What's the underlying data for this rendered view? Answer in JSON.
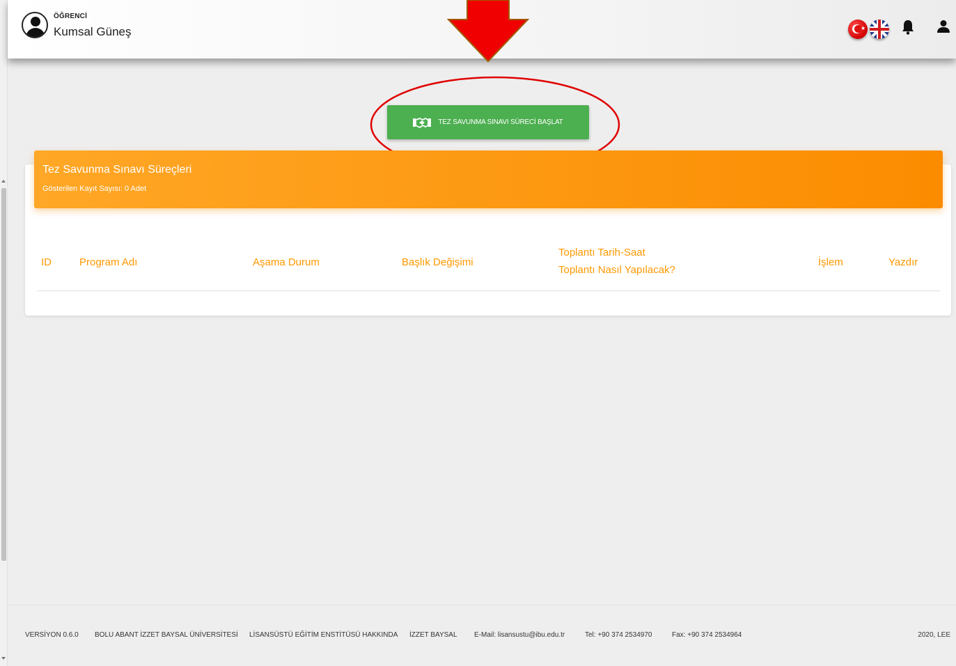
{
  "header": {
    "role": "ÖĞRENCİ",
    "username": "Kumsal Güneş",
    "icons": [
      "avatar-icon",
      "turkish-flag-icon",
      "uk-flag-icon",
      "bell-icon",
      "user-icon"
    ]
  },
  "main": {
    "start_button_label": "TEZ SAVUNMA SINAVI SÜRECİ BAŞLAT",
    "card": {
      "title": "Tez Savunma Sınavı Süreçleri",
      "subtitle": "Gösterilen Kayıt Sayısı: 0 Adet",
      "columns": {
        "id": "ID",
        "program": "Program Adı",
        "stage": "Aşama Durum",
        "title_change": "Başlık Değişimi",
        "meeting_datetime": "Toplantı Tarih-Saat",
        "meeting_method": "Toplantı Nasıl Yapılacak?",
        "action": "İşlem",
        "print": "Yazdır"
      },
      "rows": []
    }
  },
  "footer": {
    "version": "VERSİYON 0.6.0",
    "university": "BOLU ABANT İZZET BAYSAL ÜNİVERSİTESİ",
    "about": "LİSANSÜSTÜ EĞİTİM ENSTİTÜSÜ HAKKINDA",
    "izzet_baysal": "İZZET BAYSAL",
    "email": "E-Mail: lisansustu@ibu.edu.tr",
    "tel": "Tel: +90 374 2534970",
    "fax": "Fax: +90 374 2534964",
    "copyright": "2020, LEE"
  },
  "colors": {
    "accent_orange": "#fb8c00",
    "button_green": "#4caf50",
    "annotation_red": "#e00000"
  }
}
